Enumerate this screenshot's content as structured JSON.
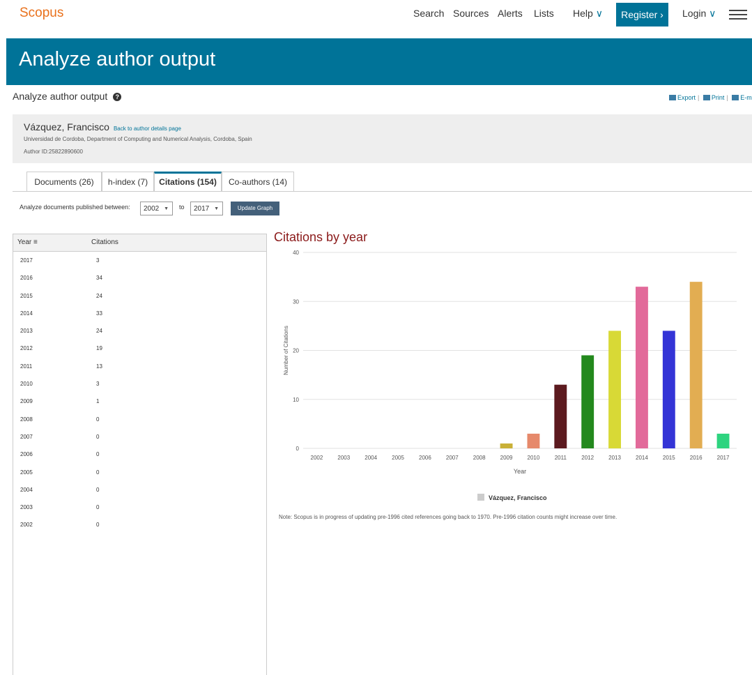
{
  "header": {
    "logo": "Scopus",
    "nav": [
      "Search",
      "Sources",
      "Alerts",
      "Lists"
    ],
    "help": "Help",
    "register": "Register",
    "login": "Login"
  },
  "banner_title": "Analyze author output",
  "page": {
    "subtitle": "Analyze author output",
    "tools": [
      "Export",
      "Print",
      "E-mail"
    ]
  },
  "author": {
    "name": "Vázquez, Francisco",
    "back_link": "Back to author details page",
    "affiliation": "Universidad de Cordoba, Department of Computing and Numerical Analysis, Cordoba, Spain",
    "id": "Author ID:25822890600"
  },
  "tabs": [
    {
      "label": "Documents (26)",
      "active": false
    },
    {
      "label": "h-index (7)",
      "active": false
    },
    {
      "label": "Citations (154)",
      "active": true
    },
    {
      "label": "Co-authors (14)",
      "active": false
    }
  ],
  "range": {
    "label": "Analyze documents published between:",
    "from": "2002",
    "to_label": "to",
    "to": "2017",
    "button": "Update Graph"
  },
  "table": {
    "headers": [
      "Year",
      "Citations"
    ],
    "rows": [
      [
        "2017",
        "3"
      ],
      [
        "2016",
        "34"
      ],
      [
        "2015",
        "24"
      ],
      [
        "2014",
        "33"
      ],
      [
        "2013",
        "24"
      ],
      [
        "2012",
        "19"
      ],
      [
        "2011",
        "13"
      ],
      [
        "2010",
        "3"
      ],
      [
        "2009",
        "1"
      ],
      [
        "2008",
        "0"
      ],
      [
        "2007",
        "0"
      ],
      [
        "2006",
        "0"
      ],
      [
        "2005",
        "0"
      ],
      [
        "2004",
        "0"
      ],
      [
        "2003",
        "0"
      ],
      [
        "2002",
        "0"
      ]
    ]
  },
  "chart_data": {
    "type": "bar",
    "title": "Citations by year",
    "xlabel": "Year",
    "ylabel": "Number of Citations",
    "ylim": [
      0,
      40
    ],
    "yticks": [
      0,
      10,
      20,
      30,
      40
    ],
    "categories": [
      "2002",
      "2003",
      "2004",
      "2005",
      "2006",
      "2007",
      "2008",
      "2009",
      "2010",
      "2011",
      "2012",
      "2013",
      "2014",
      "2015",
      "2016",
      "2017"
    ],
    "values": [
      0,
      0,
      0,
      0,
      0,
      0,
      0,
      1,
      3,
      13,
      19,
      24,
      33,
      24,
      34,
      3
    ],
    "colors": [
      "#cccccc",
      "#cccccc",
      "#cccccc",
      "#cccccc",
      "#cccccc",
      "#cccccc",
      "#cccccc",
      "#c9b037",
      "#e6896b",
      "#5c1a1f",
      "#23891d",
      "#d8d936",
      "#e26a9a",
      "#3434d6",
      "#e2ad52",
      "#2ed47f"
    ],
    "legend": "Vázquez, Francisco",
    "grid": true
  },
  "note": "Note: Scopus is in progress of updating pre-1996 cited references going back to 1970. Pre-1996 citation counts might increase over time."
}
